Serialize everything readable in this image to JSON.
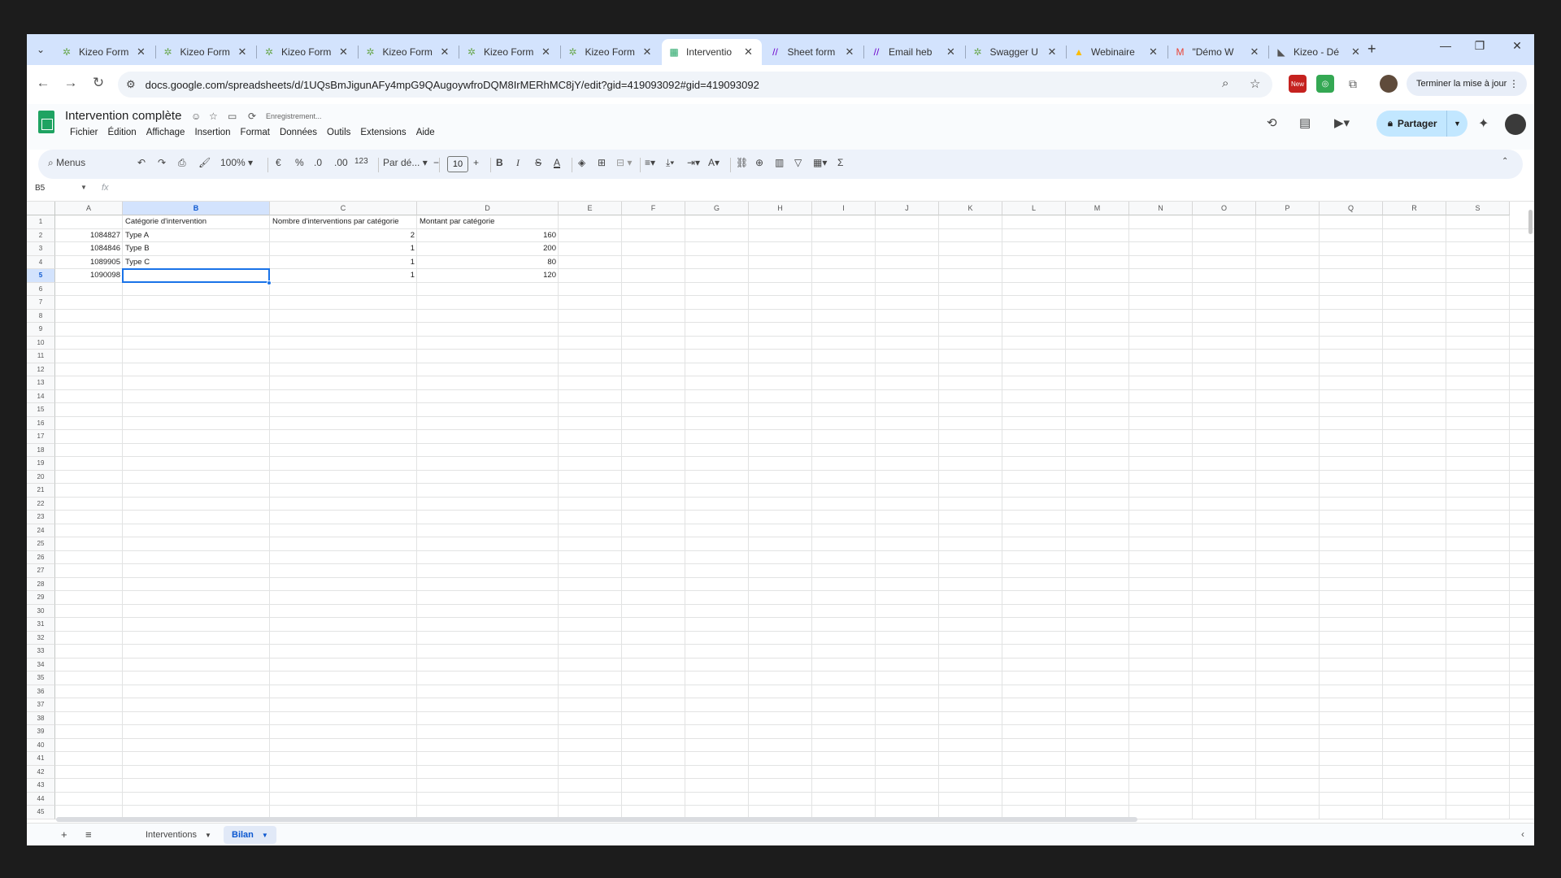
{
  "browser": {
    "tabs": [
      {
        "title": "Kizeo Form",
        "icon": "kizeo-icon",
        "active": false
      },
      {
        "title": "Kizeo Form",
        "icon": "kizeo-icon",
        "active": false
      },
      {
        "title": "Kizeo Form",
        "icon": "kizeo-icon",
        "active": false
      },
      {
        "title": "Kizeo Form",
        "icon": "kizeo-icon",
        "active": false
      },
      {
        "title": "Kizeo Form",
        "icon": "kizeo-icon",
        "active": false
      },
      {
        "title": "Kizeo Form",
        "icon": "kizeo-icon",
        "active": false
      },
      {
        "title": "Interventio",
        "icon": "sheets-icon",
        "active": true
      },
      {
        "title": "Sheet form",
        "icon": "make-icon",
        "active": false
      },
      {
        "title": "Email heb",
        "icon": "make-icon",
        "active": false
      },
      {
        "title": "Swagger U",
        "icon": "swagger-icon",
        "active": false
      },
      {
        "title": "Webinaire",
        "icon": "drive-icon",
        "active": false
      },
      {
        "title": "\"Démo W",
        "icon": "gmail-icon",
        "active": false
      },
      {
        "title": "Kizeo - Dé",
        "icon": "kizeo-chart-icon",
        "active": false
      }
    ],
    "url": "docs.google.com/spreadsheets/d/1UQsBmJigunAFy4mpG9QAugoywfroDQM8IrMERhMC8jY/edit?gid=419093092#gid=419093092",
    "update_button": "Terminer la mise à jour",
    "extension_badge": "New"
  },
  "doc": {
    "title": "Intervention complète",
    "status": "Enregistrement...",
    "menus": [
      "Fichier",
      "Édition",
      "Affichage",
      "Insertion",
      "Format",
      "Données",
      "Outils",
      "Extensions",
      "Aide"
    ],
    "share_label": "Partager"
  },
  "toolbar": {
    "menus_label": "Menus",
    "zoom": "100%",
    "currency": "€",
    "percent": "%",
    "dec_decrease": ".0",
    "dec_increase": ".00",
    "number_format": "123",
    "font": "Par dé...",
    "font_size": "10"
  },
  "formula_bar": {
    "cell_ref": "B5",
    "fx": "fx"
  },
  "sheet": {
    "columns": [
      "A",
      "B",
      "C",
      "D",
      "E",
      "F",
      "G",
      "H",
      "I",
      "J",
      "K",
      "L",
      "M",
      "N",
      "O",
      "P",
      "Q",
      "R",
      "S"
    ],
    "rows": [
      "1",
      "2",
      "3",
      "4",
      "5",
      "6",
      "7",
      "8",
      "9",
      "10",
      "11",
      "12",
      "13",
      "14",
      "15",
      "16",
      "17",
      "18",
      "19",
      "20",
      "21",
      "22",
      "23",
      "24",
      "25",
      "26",
      "27",
      "28",
      "29",
      "30",
      "31",
      "32",
      "33",
      "34",
      "35",
      "36",
      "37",
      "38",
      "39",
      "40",
      "41",
      "42",
      "43",
      "44",
      "45"
    ],
    "selected_column": "B",
    "selected_row": "5",
    "header_row": {
      "B": "Catégorie d'intervention",
      "C": "Nombre d'interventions par catégorie",
      "D": "Montant par catégorie"
    },
    "data_rows": [
      {
        "A": "1084827",
        "B": "Type A",
        "C": "2",
        "D": "160"
      },
      {
        "A": "1084846",
        "B": "Type B",
        "C": "1",
        "D": "200"
      },
      {
        "A": "1089905",
        "B": "Type C",
        "C": "1",
        "D": "80"
      },
      {
        "A": "1090098",
        "B": "",
        "C": "1",
        "D": "120"
      }
    ]
  },
  "sheet_tabs": [
    {
      "label": "Interventions",
      "active": false
    },
    {
      "label": "Bilan",
      "active": true
    }
  ],
  "colors": {
    "accent": "#1a73e8",
    "share_bg": "#c2e7ff",
    "tabstrip_bg": "#d3e3fd",
    "sheets_green": "#1ea362"
  }
}
